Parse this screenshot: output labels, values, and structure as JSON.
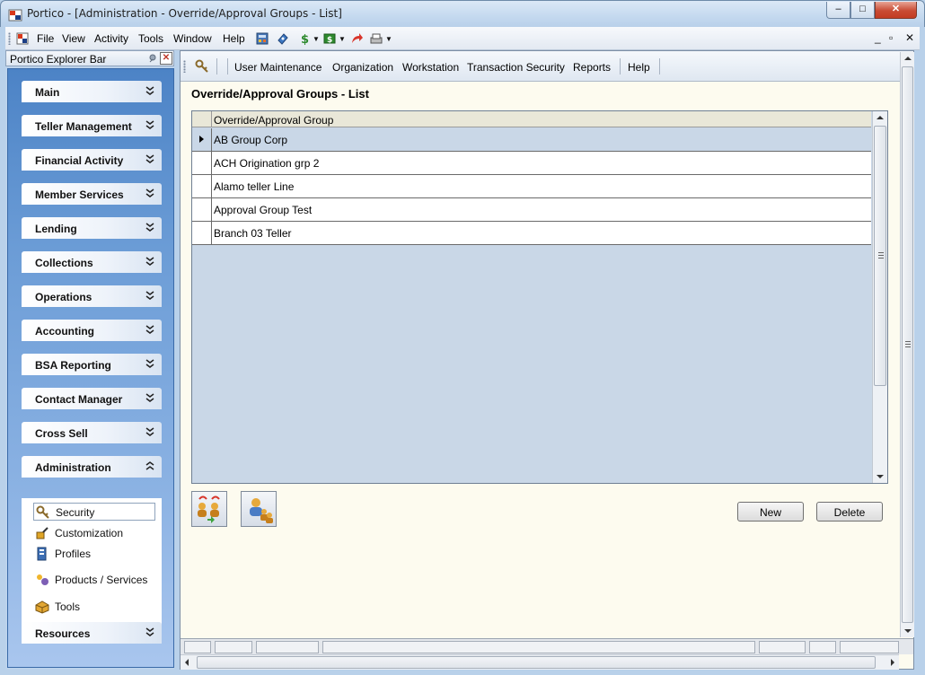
{
  "window": {
    "title": "Portico - [Administration - Override/Approval Groups - List]",
    "controls": {
      "minimize": "–",
      "maximize": "□",
      "close": "✕"
    }
  },
  "menubar": {
    "items": [
      {
        "label": "File"
      },
      {
        "label": "View"
      },
      {
        "label": "Activity"
      },
      {
        "label": "Tools"
      },
      {
        "label": "Window"
      },
      {
        "label": "Help"
      }
    ],
    "toolbar_icons": [
      "calculator-icon",
      "cash-icon",
      "dollar-icon",
      "currency-icon",
      "redo-arrow-icon",
      "print-icon"
    ],
    "mdi_controls": {
      "minimize": "_",
      "restore": "▫",
      "close": "✕"
    }
  },
  "explorer": {
    "title": "Portico Explorer Bar",
    "groups": [
      {
        "label": "Main"
      },
      {
        "label": "Teller Management"
      },
      {
        "label": "Financial Activity"
      },
      {
        "label": "Member Services"
      },
      {
        "label": "Lending"
      },
      {
        "label": "Collections"
      },
      {
        "label": "Operations"
      },
      {
        "label": "Accounting"
      },
      {
        "label": "BSA Reporting"
      },
      {
        "label": "Contact Manager"
      },
      {
        "label": "Cross Sell"
      },
      {
        "label": "Administration"
      },
      {
        "label": "Resources"
      }
    ],
    "expanded_group": "Administration",
    "tasks": [
      {
        "label": "Security",
        "icon": "security-key-icon",
        "selected": true
      },
      {
        "label": "Customization",
        "icon": "customization-icon"
      },
      {
        "label": "Profiles",
        "icon": "profiles-icon"
      },
      {
        "label": "Products / Services",
        "icon": "products-services-icon"
      },
      {
        "label": "Tools",
        "icon": "tools-box-icon"
      }
    ]
  },
  "inner_toolbar": {
    "items": [
      {
        "label": "User Maintenance"
      },
      {
        "label": "Organization"
      },
      {
        "label": "Workstation"
      },
      {
        "label": "Transaction Security"
      },
      {
        "label": "Reports"
      },
      {
        "label": "Help"
      }
    ]
  },
  "page": {
    "title": "Override/Approval Groups - List",
    "grid": {
      "column": "Override/Approval Group",
      "rows": [
        {
          "name": "AB Group Corp",
          "selected": true
        },
        {
          "name": "ACH Origination grp 2"
        },
        {
          "name": "Alamo teller Line"
        },
        {
          "name": "Approval Group Test"
        },
        {
          "name": "Branch 03 Teller"
        }
      ]
    },
    "buttons": {
      "new": "New",
      "delete": "Delete"
    },
    "icon_buttons": [
      "group-transfer-icon",
      "group-members-icon"
    ]
  },
  "colors": {
    "selection": "#c9d7e7",
    "content_bg": "#fdfbef",
    "explorer_gradient_top": "#4c83c6"
  }
}
